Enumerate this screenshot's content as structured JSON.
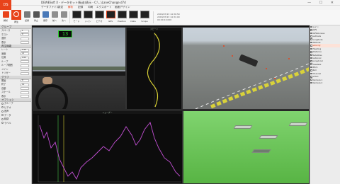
{
  "app": {
    "logo_text": "DS",
    "title": "DEWESoft X - データセット(転送)表示 - C:\\...\\LaneChange.d7d",
    "window_controls": "—  ☐  ✕"
  },
  "menu": [
    "データファイル",
    "設定",
    "解析",
    "記録",
    "印刷",
    "エクスポート",
    "画面デザイン"
  ],
  "ribbon": {
    "buttons": [
      "解析",
      "再生",
      "記録",
      "停止",
      "保存",
      "前へ",
      "次へ"
    ],
    "thumbnails": [
      "モード",
      "メイン",
      "ビデオ",
      "GPS",
      "Position",
      "Data",
      "Scope"
    ],
    "info_lines": [
      "2018/07/23 14:30:59",
      "2018/07/23 14:31:09",
      "00:00:10.000"
    ]
  },
  "left_panel": {
    "sections": [
      {
        "title": "グループ",
        "rows": [
          {
            "label": "スペース",
            "value": "1"
          },
          {
            "label": "ホスト",
            "value": "0"
          },
          {
            "label": "選択",
            "value": ""
          },
          {
            "label": "表示",
            "value": ""
          }
        ]
      },
      {
        "title": "再生機能",
        "rows": [
          {
            "label": "レート",
            "value": "1.00"
          },
          {
            "label": "速度",
            "value": "x1"
          },
          {
            "label": "位置",
            "value": "0.00"
          },
          {
            "label": "ループ",
            "value": ""
          },
          {
            "label": "ループ範囲",
            "value": ""
          },
          {
            "label": "メイン",
            "value": ""
          },
          {
            "label": "トリガー",
            "value": ""
          }
        ]
      },
      {
        "title": "グラフ",
        "rows": [
          {
            "label": "開始",
            "value": "0"
          },
          {
            "label": "終了",
            "value": "10"
          },
          {
            "label": "自動",
            "value": ""
          },
          {
            "label": "スケール",
            "value": ""
          },
          {
            "label": "表示",
            "value": ""
          }
        ]
      },
      {
        "title": "オプション",
        "rows": [
          {
            "label": "グループ",
            "value": ""
          },
          {
            "label": "ビデオ",
            "value": ""
          },
          {
            "label": "音声",
            "value": ""
          },
          {
            "label": "データ",
            "value": ""
          },
          {
            "label": "軌跡",
            "value": ""
          },
          {
            "label": "ラベル",
            "value": ""
          }
        ]
      }
    ]
  },
  "right_panel": {
    "items": [
      {
        "label": "メイン",
        "selected": false
      },
      {
        "label": "GPS",
        "selected": false
      },
      {
        "label": "GPSGlonass",
        "selected": false
      },
      {
        "label": "Latitude",
        "selected": false
      },
      {
        "label": "Longitude",
        "selected": false
      },
      {
        "label": "Altitude",
        "selected": false
      },
      {
        "label": "Velocity",
        "selected": true
      },
      {
        "label": "Heading",
        "selected": false
      },
      {
        "label": "Distance",
        "selected": false
      },
      {
        "label": "Satellites",
        "selected": false
      },
      {
        "label": "LatAccel",
        "selected": false
      },
      {
        "label": "LongAccel",
        "selected": false
      },
      {
        "label": "YawRate",
        "selected": false
      },
      {
        "label": "Pitch",
        "selected": false
      },
      {
        "label": "Roll",
        "selected": false
      },
      {
        "label": "Channel",
        "selected": false
      },
      {
        "label": "Video",
        "selected": false
      },
      {
        "label": "Camera 1",
        "selected": false
      },
      {
        "label": "Camera 2",
        "selected": false
      }
    ]
  },
  "panes": {
    "speed_display": "13",
    "speed_trace_label": "スピード",
    "graph_label": "レコーダー"
  },
  "colors": {
    "accent": "#e8431b",
    "speed_trace": "#d8d035",
    "graph_trace": "#c24fd4",
    "scene_ground": "#66c252"
  },
  "icons": [
    "close-icon",
    "minimize-icon",
    "maximize-icon"
  ]
}
